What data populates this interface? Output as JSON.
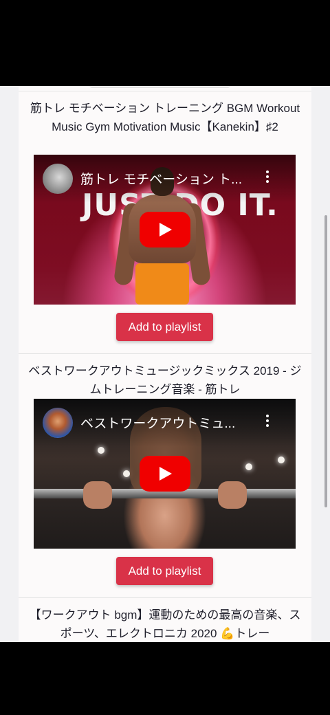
{
  "videos": [
    {
      "title": "筋トレ モチベーション トレーニング BGM Workout Music Gym Motivation Music【Kanekin】♯2",
      "player_title": "筋トレ モチベーション ト...",
      "thumbnail_text": "JUST DO IT.",
      "button_label": "Add to playlist"
    },
    {
      "title": "ベストワークアウトミュージックミックス 2019 - ジムトレーニング音楽 - 筋トレ",
      "player_title": "ベストワークアウトミュ...",
      "button_label": "Add to playlist"
    },
    {
      "title": "【ワークアウト bgm】運動のための最高の音楽、スポーツ、エレクトロニカ 2020 💪トレー"
    }
  ],
  "colors": {
    "accent_button": "#d93248",
    "youtube_red": "#f00000",
    "card_background": "#fcfafa",
    "page_background": "#f1f1f3"
  },
  "icons": {
    "play": "play-icon",
    "menu": "more-vert-icon"
  }
}
